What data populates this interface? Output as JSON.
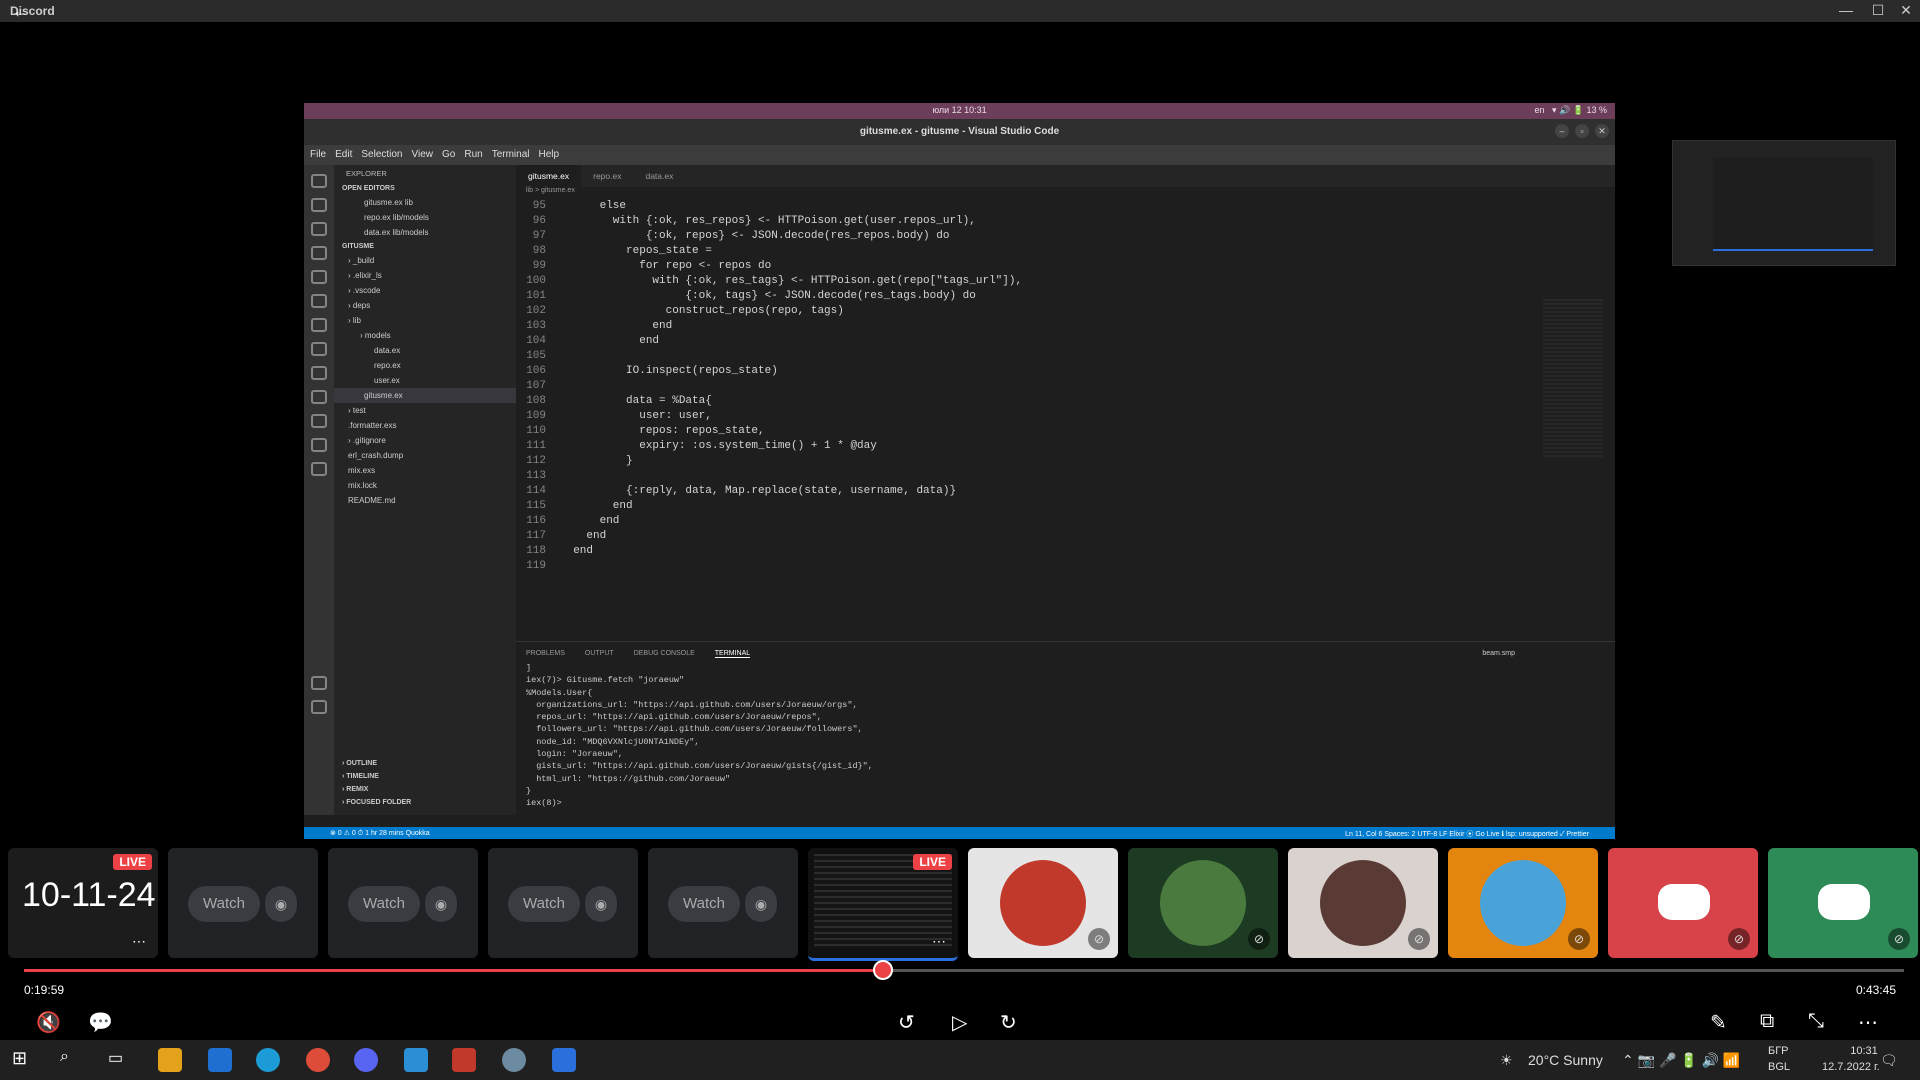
{
  "window": {
    "app_name": "Discord",
    "back_icon": "arrow-left-icon",
    "minimize": "—",
    "maximize": "☐",
    "close": "✕"
  },
  "stream": {
    "gnome_bar": {
      "clock": "юли 12  10:31",
      "lang": "en",
      "battery": "13 %"
    },
    "vscode": {
      "title": "gitusme.ex - gitusme - Visual Studio Code",
      "menu": [
        "File",
        "Edit",
        "Selection",
        "View",
        "Go",
        "Run",
        "Terminal",
        "Help"
      ],
      "tabs": [
        {
          "label": "gitusme.ex",
          "active": true
        },
        {
          "label": "repo.ex",
          "active": false
        },
        {
          "label": "data.ex",
          "active": false
        }
      ],
      "breadcrumb": "lib > gitusme.ex",
      "explorer": {
        "header": "EXPLORER",
        "open_editors_title": "OPEN EDITORS",
        "open_editors": [
          "gitusme.ex  lib",
          "repo.ex  lib/models",
          "data.ex  lib/models"
        ],
        "project_title": "GITUSME",
        "tree": [
          "_build",
          ".elixir_ls",
          ".vscode",
          "deps",
          "lib",
          "models",
          "data.ex",
          "repo.ex",
          "user.ex",
          "gitusme.ex",
          "test",
          ".formatter.exs",
          ".gitignore",
          "erl_crash.dump",
          "mix.exs",
          "mix.lock",
          "README.md"
        ],
        "bottom_sections": [
          "OUTLINE",
          "TIMELINE",
          "REMIX",
          "FOCUSED FOLDER"
        ]
      },
      "code": [
        {
          "n": "95",
          "t": "      else"
        },
        {
          "n": "96",
          "t": "        with {:ok, res_repos} <- HTTPoison.get(user.repos_url),"
        },
        {
          "n": "97",
          "t": "             {:ok, repos} <- JSON.decode(res_repos.body) do"
        },
        {
          "n": "98",
          "t": "          repos_state ="
        },
        {
          "n": "99",
          "t": "            for repo <- repos do"
        },
        {
          "n": "100",
          "t": "              with {:ok, res_tags} <- HTTPoison.get(repo[\"tags_url\"]),"
        },
        {
          "n": "101",
          "t": "                   {:ok, tags} <- JSON.decode(res_tags.body) do"
        },
        {
          "n": "102",
          "t": "                construct_repos(repo, tags)"
        },
        {
          "n": "103",
          "t": "              end"
        },
        {
          "n": "104",
          "t": "            end"
        },
        {
          "n": "105",
          "t": ""
        },
        {
          "n": "106",
          "t": "          IO.inspect(repos_state)"
        },
        {
          "n": "107",
          "t": ""
        },
        {
          "n": "108",
          "t": "          data = %Data{"
        },
        {
          "n": "109",
          "t": "            user: user,"
        },
        {
          "n": "110",
          "t": "            repos: repos_state,"
        },
        {
          "n": "111",
          "t": "            expiry: :os.system_time() + 1 * @day"
        },
        {
          "n": "112",
          "t": "          }"
        },
        {
          "n": "113",
          "t": ""
        },
        {
          "n": "114",
          "t": "          {:reply, data, Map.replace(state, username, data)}"
        },
        {
          "n": "115",
          "t": "        end"
        },
        {
          "n": "116",
          "t": "      end"
        },
        {
          "n": "117",
          "t": "    end"
        },
        {
          "n": "118",
          "t": "  end"
        },
        {
          "n": "119",
          "t": ""
        }
      ],
      "panel_tabs": [
        "PROBLEMS",
        "OUTPUT",
        "DEBUG CONSOLE",
        "TERMINAL"
      ],
      "panel_active": "TERMINAL",
      "terminal_label": "beam.smp",
      "terminal": [
        "]",
        "iex(7)> Gitusme.fetch \"joraeuw\"",
        "%Models.User{",
        "  organizations_url: \"https://api.github.com/users/Joraeuw/orgs\",",
        "  repos_url: \"https://api.github.com/users/Joraeuw/repos\",",
        "  followers_url: \"https://api.github.com/users/Joraeuw/followers\",",
        "  node_id: \"MDQ6VXNlcjU0NTA1NDEy\",",
        "  login: \"Joraeuw\",",
        "  gists_url: \"https://api.github.com/users/Joraeuw/gists{/gist_id}\",",
        "  html_url: \"https://github.com/Joraeuw\"",
        "}",
        "iex(8)> "
      ],
      "status_left": "⊗ 0 ⚠ 0   ⏱ 1 hr 28 mins   Quokka",
      "status_right": "Ln 11, Col 6   Spaces: 2   UTF-8   LF   Elixir   ⦿ Go Live   ℹ lsp: unsupported   ✓ Prettier"
    }
  },
  "participants": [
    {
      "kind": "clock",
      "text": "10-11-24",
      "live": "LIVE"
    },
    {
      "kind": "watch",
      "label": "Watch"
    },
    {
      "kind": "watch",
      "label": "Watch"
    },
    {
      "kind": "watch",
      "label": "Watch"
    },
    {
      "kind": "watch",
      "label": "Watch"
    },
    {
      "kind": "screen",
      "live": "LIVE"
    },
    {
      "kind": "avatar",
      "bg": "#e5e5e5",
      "av": "#c0392b"
    },
    {
      "kind": "avatar",
      "bg": "#1c3b22",
      "av": "#4b7a3e"
    },
    {
      "kind": "avatar",
      "bg": "#d9d2cf",
      "av": "#5a3a34"
    },
    {
      "kind": "avatar",
      "bg": "#e3850f",
      "av": "#4aa3d8"
    },
    {
      "kind": "discord",
      "bg": "#d8434a"
    },
    {
      "kind": "discord",
      "bg": "#2e8b57"
    }
  ],
  "player": {
    "elapsed": "0:19:59",
    "duration": "0:43:45",
    "progress": 0.4568,
    "accent": "#ed4245"
  },
  "taskbar": {
    "weather": "20°C  Sunny",
    "lang": "БГР",
    "lang2": "BGL",
    "time": "10:31",
    "date": "12.7.2022 г."
  }
}
